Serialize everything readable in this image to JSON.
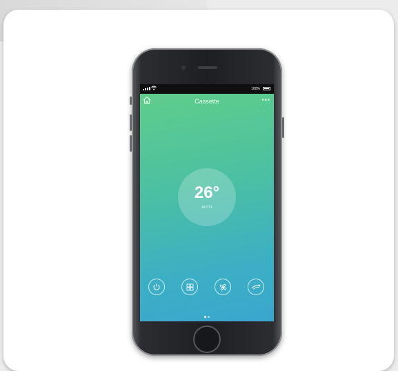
{
  "status_bar": {
    "battery_text": "100%"
  },
  "app": {
    "title": "Cassette",
    "more_icon": "more-icon",
    "home_icon": "home-icon"
  },
  "thermostat": {
    "temperature": "26°",
    "mode": "AUTO"
  },
  "controls": [
    {
      "icon": "power-icon"
    },
    {
      "icon": "mode-icon"
    },
    {
      "icon": "fan-icon"
    },
    {
      "icon": "swing-icon"
    }
  ],
  "page_indicator": {
    "count": 2,
    "active": 0
  },
  "colors": {
    "gradient_top": "#5fcd8b",
    "gradient_bottom": "#3aa7cf",
    "phone_frame": "#1d1f23"
  }
}
